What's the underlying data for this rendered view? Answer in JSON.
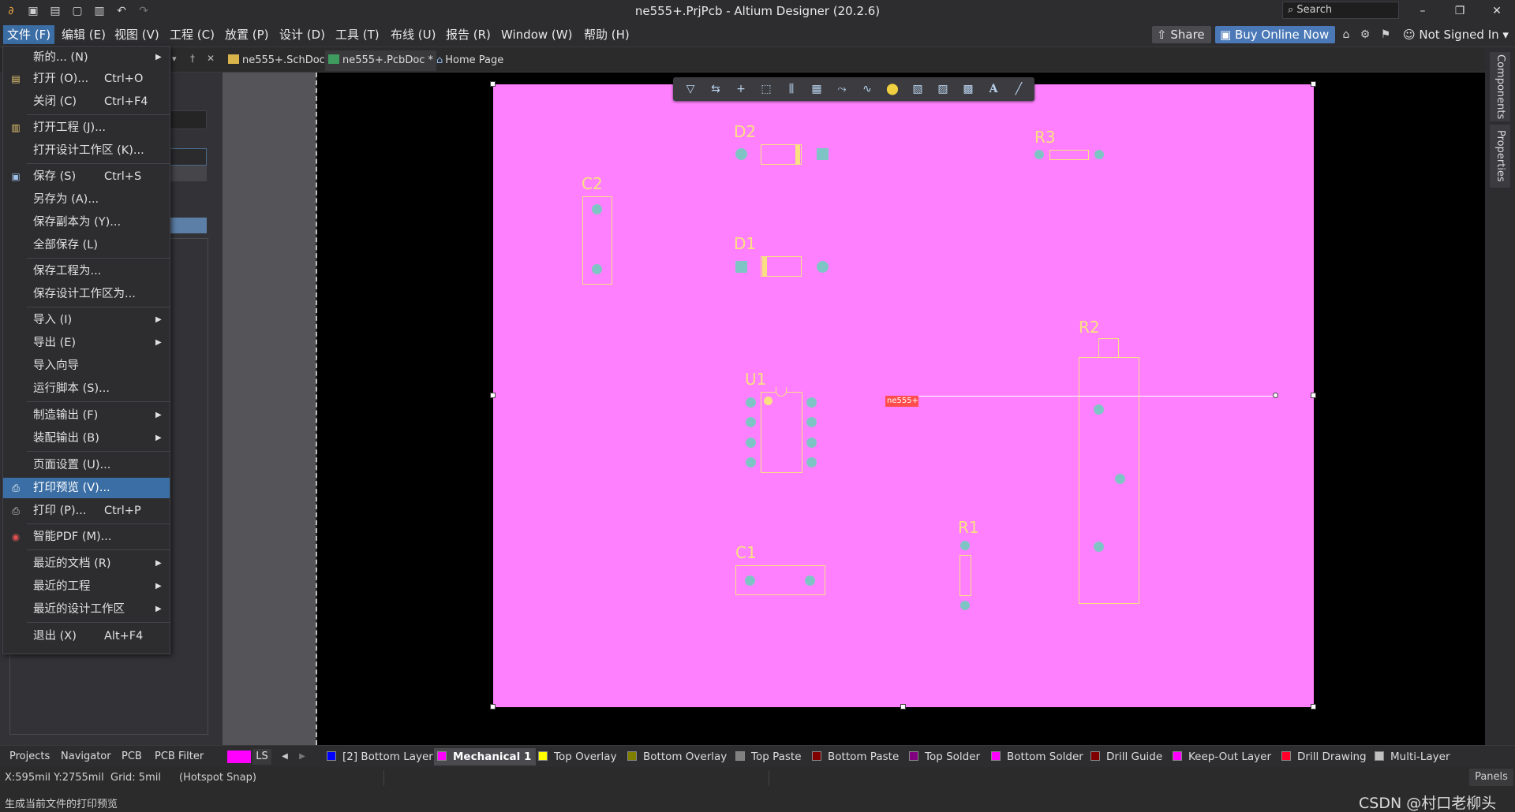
{
  "window": {
    "title": "ne555+.PrjPcb - Altium Designer (20.2.6)",
    "search_placeholder": "Search",
    "controls": {
      "minimize": "–",
      "restore": "❐",
      "close": "✕"
    }
  },
  "menubar": {
    "items": [
      "文件 (F)",
      "编辑 (E)",
      "视图 (V)",
      "工程 (C)",
      "放置 (P)",
      "设计 (D)",
      "工具 (T)",
      "布线 (U)",
      "报告 (R)",
      "Window (W)",
      "帮助 (H)"
    ],
    "share": "Share",
    "buy": "Buy Online Now",
    "account": "Not Signed In"
  },
  "tabs": [
    {
      "label": "ne555+.SchDoc"
    },
    {
      "label": "ne555+.PcbDoc *"
    },
    {
      "label": "Home Page"
    }
  ],
  "right_panels": [
    "Components",
    "Properties"
  ],
  "file_menu": {
    "items": [
      {
        "label": "新的... (N)",
        "shortcut": "",
        "submenu": true,
        "icon": ""
      },
      {
        "label": "打开 (O)...",
        "shortcut": "Ctrl+O",
        "submenu": false,
        "icon": "folder-open-icon"
      },
      {
        "label": "关闭 (C)",
        "shortcut": "Ctrl+F4",
        "submenu": false,
        "icon": ""
      },
      {
        "label": "打开工程 (J)...",
        "shortcut": "",
        "submenu": false,
        "icon": "open-project-icon"
      },
      {
        "label": "打开设计工作区 (K)...",
        "shortcut": "",
        "submenu": false,
        "icon": ""
      },
      {
        "label": "保存 (S)",
        "shortcut": "Ctrl+S",
        "submenu": false,
        "icon": "save-icon"
      },
      {
        "label": "另存为 (A)...",
        "shortcut": "",
        "submenu": false,
        "icon": ""
      },
      {
        "label": "保存副本为 (Y)...",
        "shortcut": "",
        "submenu": false,
        "icon": ""
      },
      {
        "label": "全部保存 (L)",
        "shortcut": "",
        "submenu": false,
        "icon": ""
      },
      {
        "label": "保存工程为...",
        "shortcut": "",
        "submenu": false,
        "icon": ""
      },
      {
        "label": "保存设计工作区为...",
        "shortcut": "",
        "submenu": false,
        "icon": ""
      },
      {
        "label": "导入 (I)",
        "shortcut": "",
        "submenu": true,
        "icon": ""
      },
      {
        "label": "导出 (E)",
        "shortcut": "",
        "submenu": true,
        "icon": ""
      },
      {
        "label": "导入向导",
        "shortcut": "",
        "submenu": false,
        "icon": ""
      },
      {
        "label": "运行脚本 (S)...",
        "shortcut": "",
        "submenu": false,
        "icon": ""
      },
      {
        "label": "制造输出 (F)",
        "shortcut": "",
        "submenu": true,
        "icon": ""
      },
      {
        "label": "装配输出 (B)",
        "shortcut": "",
        "submenu": true,
        "icon": ""
      },
      {
        "label": "页面设置 (U)...",
        "shortcut": "",
        "submenu": false,
        "icon": ""
      },
      {
        "label": "打印预览 (V)...",
        "shortcut": "",
        "submenu": false,
        "icon": "print-preview-icon",
        "highlighted": true
      },
      {
        "label": "打印 (P)...",
        "shortcut": "Ctrl+P",
        "submenu": false,
        "icon": "printer-icon"
      },
      {
        "label": "智能PDF (M)...",
        "shortcut": "",
        "submenu": false,
        "icon": "smart-pdf-icon"
      },
      {
        "label": "最近的文档 (R)",
        "shortcut": "",
        "submenu": true,
        "icon": ""
      },
      {
        "label": "最近的工程",
        "shortcut": "",
        "submenu": true,
        "icon": ""
      },
      {
        "label": "最近的设计工作区",
        "shortcut": "",
        "submenu": true,
        "icon": ""
      },
      {
        "label": "退出 (X)",
        "shortcut": "Alt+F4",
        "submenu": false,
        "icon": ""
      }
    ]
  },
  "pcb": {
    "designators": [
      "D2",
      "R3",
      "C2",
      "D1",
      "R2",
      "U1",
      "R1",
      "C1"
    ],
    "net_label": "ne555+",
    "board_color": "#fe80fe",
    "silk_color": "#fbe082",
    "pad_color": "#7fc4c4"
  },
  "bottom_panel_tabs": [
    "Projects",
    "Navigator",
    "PCB",
    "PCB Filter"
  ],
  "layers": {
    "ls": "LS",
    "items": [
      {
        "label": "[2] Bottom Layer",
        "color": "#0000ff"
      },
      {
        "label": "Mechanical 1",
        "color": "#ff00ff",
        "active": true
      },
      {
        "label": "Top Overlay",
        "color": "#ffff00"
      },
      {
        "label": "Bottom Overlay",
        "color": "#808000"
      },
      {
        "label": "Top Paste",
        "color": "#808080"
      },
      {
        "label": "Bottom Paste",
        "color": "#800000"
      },
      {
        "label": "Top Solder",
        "color": "#800080"
      },
      {
        "label": "Bottom Solder",
        "color": "#ff00ff"
      },
      {
        "label": "Drill Guide",
        "color": "#800000"
      },
      {
        "label": "Keep-Out Layer",
        "color": "#ff00ff"
      },
      {
        "label": "Drill Drawing",
        "color": "#ff002a"
      },
      {
        "label": "Multi-Layer",
        "color": "#c0c0c0"
      }
    ]
  },
  "status": {
    "coords": "X:595mil Y:2755mil",
    "grid": "Grid: 5mil",
    "snap": "(Hotspot Snap)",
    "panels": "Panels",
    "hint": "生成当前文件的打印预览",
    "watermark": "CSDN @村口老柳头"
  }
}
